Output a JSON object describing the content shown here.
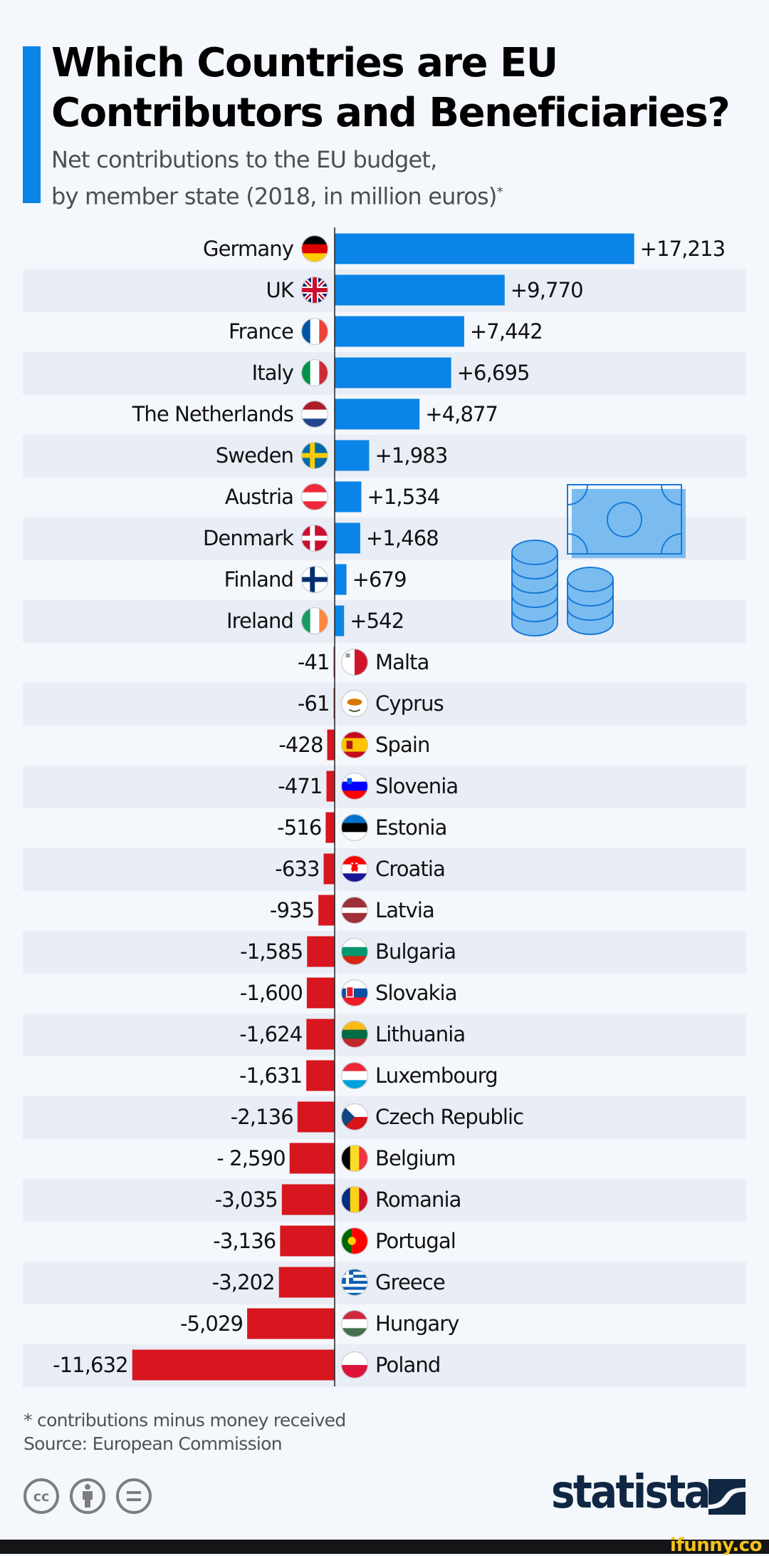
{
  "header": {
    "title_line1": "Which Countries are EU",
    "title_line2": "Contributors and Beneficiaries?",
    "subtitle_line1": "Net contributions to the EU budget,",
    "subtitle_line2": "by member state (2018, in million euros)",
    "subtitle_asterisk": "*"
  },
  "colors": {
    "positive": "#0a84e6",
    "negative": "#d7161f",
    "stripe": "#e9eef6",
    "background": "#f4f7fb",
    "accent": "#0a84e6",
    "illustration": "#7bbcf0",
    "illustration_stroke": "#1a7ad6",
    "brand": "#0f2742"
  },
  "chart_data": {
    "type": "bar",
    "orientation": "horizontal",
    "title": "Which Countries are EU Contributors and Beneficiaries?",
    "subtitle": "Net contributions to the EU budget, by member state (2018, in million euros)*",
    "xlabel": "",
    "ylabel": "",
    "unit": "million euros",
    "grid": false,
    "legend": "none",
    "categories": [
      "Germany",
      "UK",
      "France",
      "Italy",
      "The Netherlands",
      "Sweden",
      "Austria",
      "Denmark",
      "Finland",
      "Ireland",
      "Malta",
      "Cyprus",
      "Spain",
      "Slovenia",
      "Estonia",
      "Croatia",
      "Latvia",
      "Bulgaria",
      "Slovakia",
      "Lithuania",
      "Luxembourg",
      "Czech Republic",
      "Belgium",
      "Romania",
      "Portugal",
      "Greece",
      "Hungary",
      "Poland"
    ],
    "values": [
      17213,
      9770,
      7442,
      6695,
      4877,
      1983,
      1534,
      1468,
      679,
      542,
      -41,
      -61,
      -428,
      -471,
      -516,
      -633,
      -935,
      -1585,
      -1600,
      -1624,
      -1631,
      -2136,
      -2590,
      -3035,
      -3136,
      -3202,
      -5029,
      -11632
    ],
    "value_labels": [
      "+17,213",
      "+9,770",
      "+7,442",
      "+6,695",
      "+4,877",
      "+1,983",
      "+1,534",
      "+1,468",
      "+679",
      "+542",
      "-41",
      "-61",
      "-428",
      "-471",
      "-516",
      "-633",
      "-935",
      "-1,585",
      "-1,600",
      "-1,624",
      "-1,631",
      "-2,136",
      "- 2,590",
      "-3,035",
      "-3,136",
      "-3,202",
      "-5,029",
      "-11,632"
    ],
    "flags": [
      "de",
      "gb",
      "fr",
      "it",
      "nl",
      "se",
      "at",
      "dk",
      "fi",
      "ie",
      "mt",
      "cy",
      "es",
      "si",
      "ee",
      "hr",
      "lv",
      "bg",
      "sk",
      "lt",
      "lu",
      "cz",
      "be",
      "ro",
      "pt",
      "gr",
      "hu",
      "pl"
    ],
    "xlim": [
      -11632,
      17213
    ]
  },
  "illustration": {
    "name": "money-bill-and-coins-icon"
  },
  "footer": {
    "note": "* contributions minus money received",
    "source": "Source: European Commission",
    "license_icons": [
      "creative-commons-icon",
      "attribution-icon",
      "no-derivatives-icon"
    ],
    "brand": "statista",
    "watermark": "ifunny.co"
  }
}
